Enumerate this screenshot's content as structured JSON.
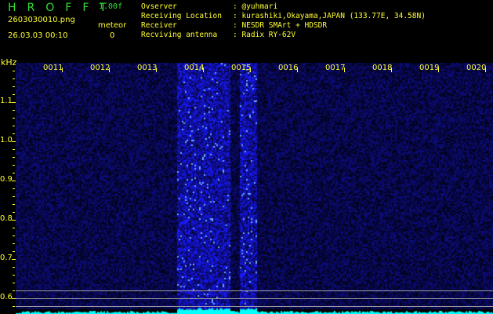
{
  "header": {
    "app_title": "HROFFT",
    "version": "1.00f",
    "filename": "2603030010.png",
    "datetime": "26.03.03 00:10",
    "meteor_label": "meteor",
    "meteor_count": "0"
  },
  "info": [
    {
      "label": "Ovserver",
      "value": ": @yuhmari"
    },
    {
      "label": "Receiving Location",
      "value": ": kurashiki,Okayama,JAPAN (133.77E, 34.58N)"
    },
    {
      "label": "Receiver",
      "value": ": NESDR SMArt + HDSDR"
    },
    {
      "label": "Recviving antenna",
      "value": ": Radix RY-62V"
    }
  ],
  "spectrogram": {
    "y_unit": "kHz",
    "y_ticks": [
      "1.1",
      "1.0",
      "0.9",
      "0.8",
      "0.7",
      "0.6"
    ],
    "time_labels": [
      "0011",
      "0012",
      "0013",
      "0014",
      "0015",
      "0016",
      "0017",
      "0018",
      "0019",
      "0020"
    ],
    "colors": {
      "background": "#000000",
      "noise": "#1a1aa0",
      "bright": "#3344ff",
      "level": "#00ffff",
      "marker_lines": "#a0a0a0",
      "text": "#ffff33",
      "title": "#33dd33"
    }
  }
}
